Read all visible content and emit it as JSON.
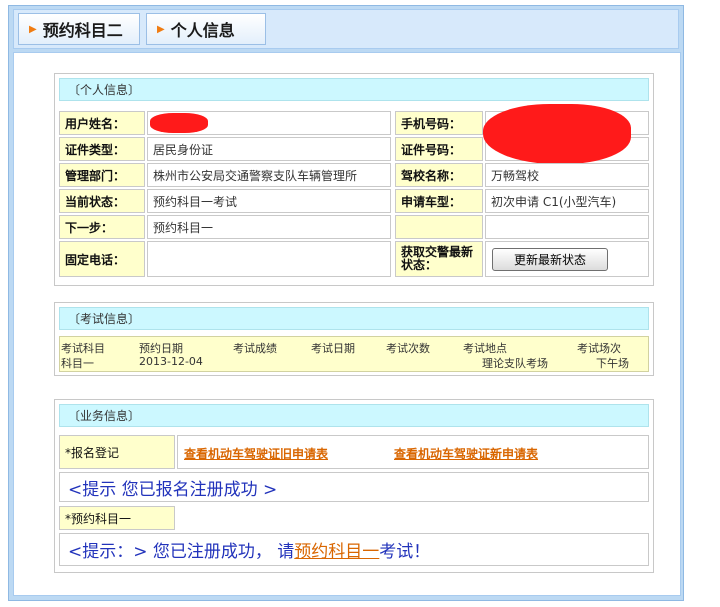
{
  "tabs": [
    {
      "label": "预约科目二"
    },
    {
      "label": "个人信息"
    }
  ],
  "personal": {
    "header": "〔个人信息〕",
    "rows": [
      {
        "l1": "用户姓名：",
        "v1": "",
        "l2": "手机号码：",
        "v2": ""
      },
      {
        "l1": "证件类型：",
        "v1": "居民身份证",
        "l2": "证件号码：",
        "v2": ""
      },
      {
        "l1": "管理部门：",
        "v1": "株州市公安局交通警察支队车辆管理所",
        "l2": "驾校名称：",
        "v2": "万畅驾校"
      },
      {
        "l1": "当前状态：",
        "v1": "预约科目一考试",
        "l2": "申请车型：",
        "v2": "初次申请  C1(小型汽车)"
      },
      {
        "l1": "下一步：",
        "v1": "预约科目一",
        "l2": "",
        "v2": ""
      },
      {
        "l1": "固定电话：",
        "v1": "",
        "l2": "获取交警最新状态："
      }
    ],
    "refresh_button": "更新最新状态"
  },
  "exam": {
    "header": "〔考试信息〕",
    "columns": [
      "考试科目",
      "预约日期",
      "考试成绩",
      "考试日期",
      "考试次数",
      "考试地点",
      "考试场次"
    ],
    "row": [
      "科目一",
      "2013-12-04",
      "",
      "",
      "",
      "理论支队考场",
      "下午场"
    ]
  },
  "business": {
    "header": "〔业务信息〕",
    "reg_label": "*报名登记",
    "link_old": "查看机动车驾驶证旧申请表",
    "link_new": "查看机动车驾驶证新申请表",
    "hint1": "<提示 您已报名注册成功 >",
    "subject1_label": "*预约科目一",
    "hint2_prefix": "<提示：> 您已注册成功， 请",
    "hint2_link": "预约科目一",
    "hint2_suffix": "考试！"
  },
  "colors": {
    "label_bg": "#ffffcc",
    "header_bg": "#ccf8ff",
    "link": "#d96600",
    "hint": "#2233bb",
    "redaction": "#ff1a1a"
  }
}
